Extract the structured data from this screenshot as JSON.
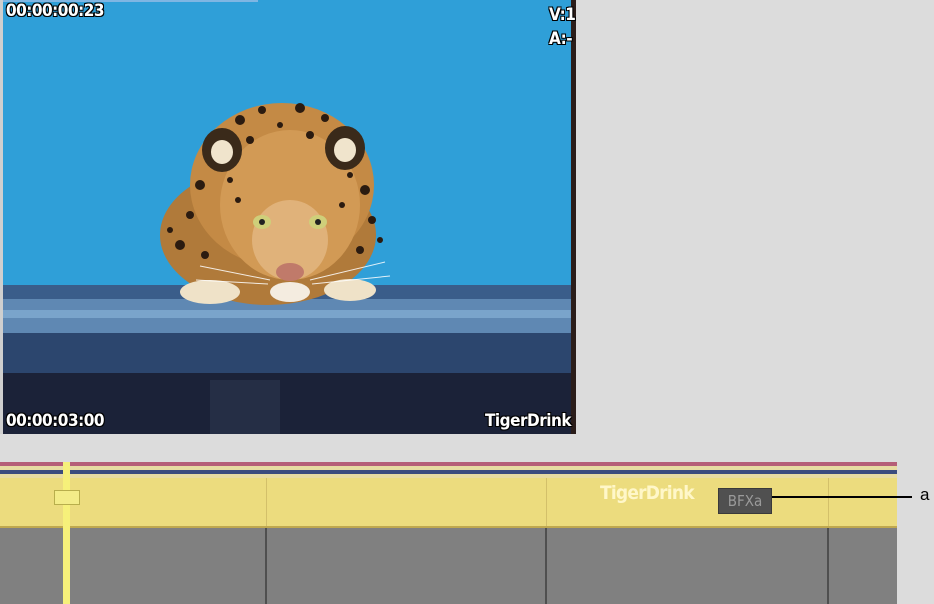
{
  "viewer": {
    "timecode_top": "00:00:00:23",
    "track_v": "V:1",
    "track_a": "A:-",
    "timecode_bottom": "00:00:03:00",
    "clip_name": "TigerDrink"
  },
  "timeline": {
    "segment_title": "TigerDrink",
    "effect_badge": "BFXa"
  },
  "callout": {
    "label": "a"
  },
  "colors": {
    "viewer_background": "#2f9fd8",
    "video_track": "#ecdc7e",
    "audio_track": "#808080",
    "playhead": "#f6f07a",
    "record_line_red": "#b55e78",
    "record_line_blue": "#3b4c7e"
  }
}
